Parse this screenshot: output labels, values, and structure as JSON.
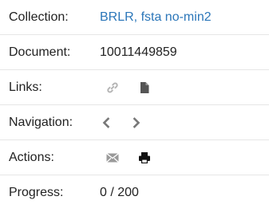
{
  "rows": {
    "collection": {
      "label": "Collection:",
      "value": "BRLR, fsta no-min2"
    },
    "document": {
      "label": "Document:",
      "value": "10011449859"
    },
    "links": {
      "label": "Links:",
      "icons": [
        "link-icon",
        "file-icon"
      ]
    },
    "navigation": {
      "label": "Navigation:",
      "icons": [
        "chevron-left-icon",
        "chevron-right-icon"
      ]
    },
    "actions": {
      "label": "Actions:",
      "icons": [
        "envelope-icon",
        "print-icon"
      ]
    },
    "progress": {
      "label": "Progress:",
      "value": "0 / 200"
    }
  },
  "colors": {
    "link": "#2b76b9",
    "icon_muted": "#b5b5b5",
    "icon_dark": "#555555",
    "icon_black": "#111111"
  }
}
